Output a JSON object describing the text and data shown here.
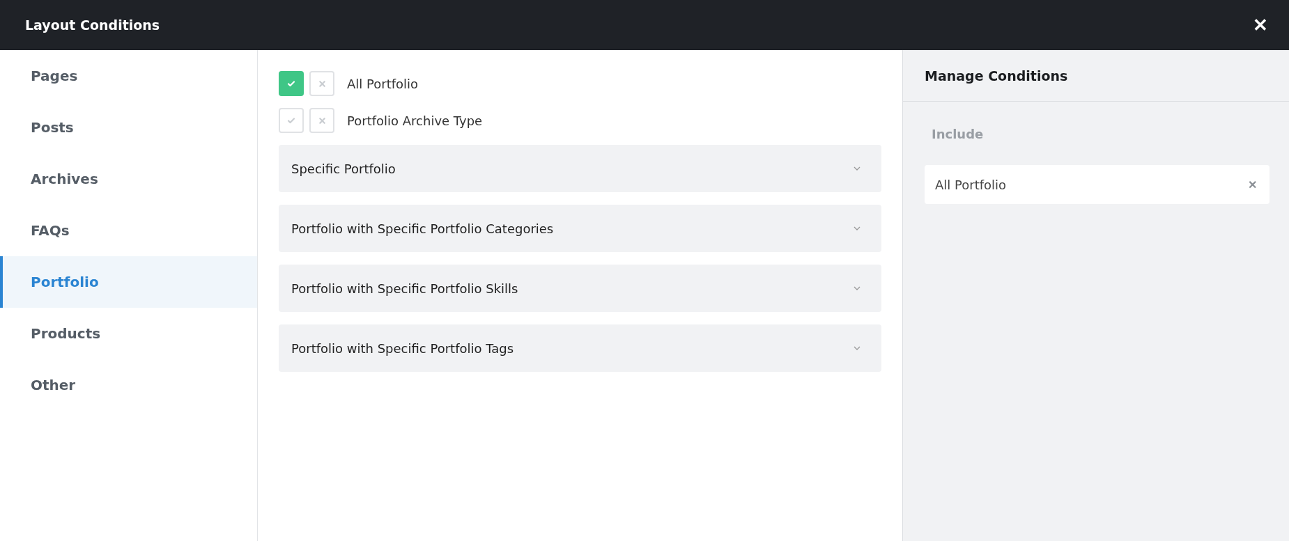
{
  "window": {
    "title": "Layout Conditions",
    "close": "✕"
  },
  "sidebar": {
    "items": [
      {
        "label": "Pages",
        "selected": false
      },
      {
        "label": "Posts",
        "selected": false
      },
      {
        "label": "Archives",
        "selected": false
      },
      {
        "label": "FAQs",
        "selected": false
      },
      {
        "label": "Portfolio",
        "selected": true
      },
      {
        "label": "Products",
        "selected": false
      },
      {
        "label": "Other",
        "selected": false
      }
    ]
  },
  "conditions": [
    {
      "label": "All Portfolio",
      "included": true,
      "excluded": false
    },
    {
      "label": "Portfolio Archive Type",
      "included": false,
      "excluded": false
    }
  ],
  "accordions": [
    {
      "label": "Specific Portfolio",
      "expanded": false
    },
    {
      "label": "Portfolio with Specific Portfolio Categories",
      "expanded": false
    },
    {
      "label": "Portfolio with Specific Portfolio Skills",
      "expanded": false
    },
    {
      "label": "Portfolio with Specific Portfolio Tags",
      "expanded": false
    }
  ],
  "manage": {
    "title": "Manage Conditions",
    "groups": [
      {
        "heading": "Include",
        "items": [
          {
            "label": "All Portfolio",
            "remove": "✕"
          }
        ]
      }
    ]
  }
}
